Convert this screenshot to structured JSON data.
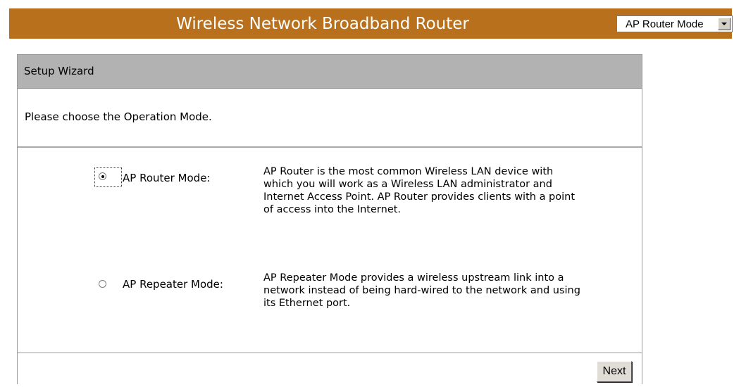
{
  "header": {
    "title": "Wireless Network Broadband Router",
    "mode_select": {
      "selected": "AP Router Mode"
    },
    "bar_color": "#b8701c"
  },
  "panel": {
    "title": "Setup Wizard",
    "instruction": "Please choose the Operation Mode.",
    "modes": [
      {
        "label": "AP Router Mode:",
        "checked": true,
        "description": "AP Router is the most common Wireless LAN device with which you will work as a Wireless LAN administrator and Internet Access Point. AP Router provides clients with a point of access into the Internet."
      },
      {
        "label": "AP Repeater Mode:",
        "checked": false,
        "description": "AP Repeater Mode provides a wireless upstream link into a network instead of being hard-wired to the network and using its Ethernet port."
      }
    ],
    "next_label": "Next"
  }
}
